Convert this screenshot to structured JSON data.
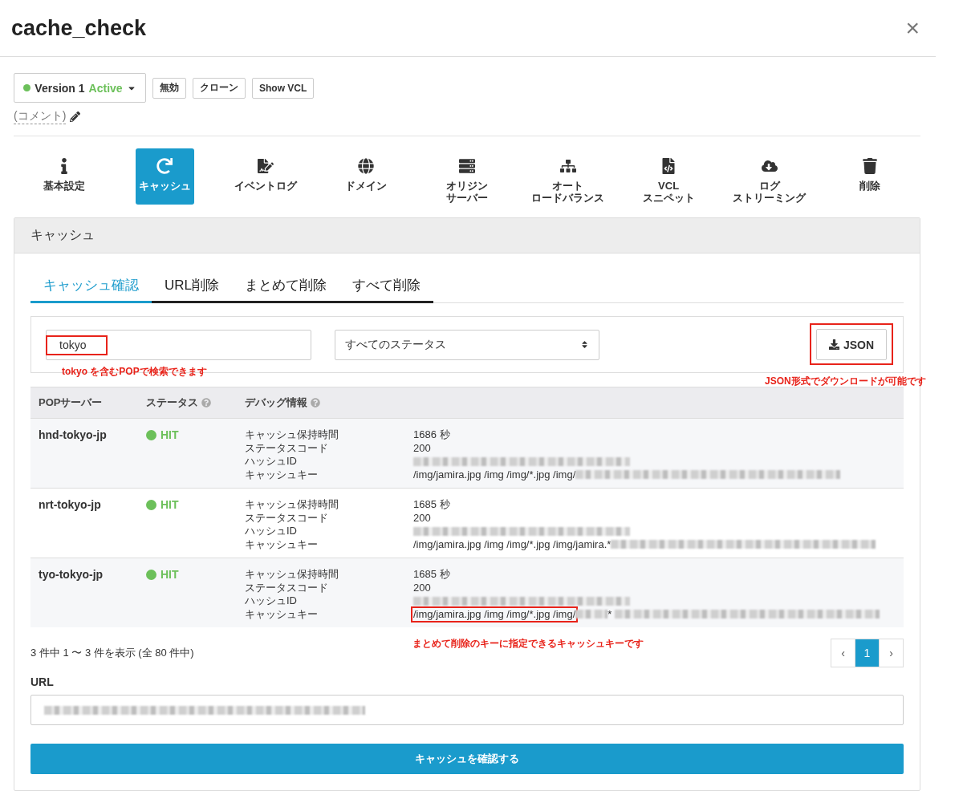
{
  "dialog": {
    "title": "cache_check",
    "close": "×"
  },
  "version": {
    "label": "Version 1",
    "status": "Active",
    "active": true
  },
  "version_buttons": [
    "無効",
    "クローン",
    "Show VCL"
  ],
  "comment": "(コメント)",
  "nav": [
    {
      "lines": [
        "基本設定"
      ],
      "selected": false
    },
    {
      "lines": [
        "キャッシュ"
      ],
      "selected": true
    },
    {
      "lines": [
        "イベントログ"
      ],
      "selected": false
    },
    {
      "lines": [
        "ドメイン"
      ],
      "selected": false
    },
    {
      "lines": [
        "オリジン",
        "サーバー"
      ],
      "selected": false
    },
    {
      "lines": [
        "オート",
        "ロードバランス"
      ],
      "selected": false
    },
    {
      "lines": [
        "VCL",
        "スニペット"
      ],
      "selected": false
    },
    {
      "lines": [
        "ログ",
        "ストリーミング"
      ],
      "selected": false
    },
    {
      "lines": [
        "削除"
      ],
      "selected": false
    }
  ],
  "panel_title": "キャッシュ",
  "tabs": [
    {
      "label": "キャッシュ確認",
      "selected": true
    },
    {
      "label": "URL削除",
      "selected": false
    },
    {
      "label": "まとめて削除",
      "selected": false
    },
    {
      "label": "すべて削除",
      "selected": false
    }
  ],
  "search": {
    "value": "tokyo"
  },
  "status_filter": "すべてのステータス",
  "json_button": "JSON",
  "table": {
    "columns": [
      {
        "label": "POPサーバー"
      },
      {
        "label": "ステータス",
        "help": true
      },
      {
        "label": "デバッグ情報",
        "help": true
      }
    ],
    "rows": [
      {
        "pop": "hnd-tokyo-jp",
        "status": "HIT",
        "hit": true,
        "debug": [
          {
            "label": "キャッシュ保持時間",
            "segments": [
              {
                "kind": "text",
                "text": "1686 秒"
              }
            ]
          },
          {
            "label": "ステータスコード",
            "segments": [
              {
                "kind": "text",
                "text": "200"
              }
            ]
          },
          {
            "label": "ハッシュID",
            "segments": [
              {
                "kind": "blur"
              }
            ]
          },
          {
            "label": "キャッシュキー",
            "segments": [
              {
                "kind": "text",
                "text": "/img/jamira.jpg /img /img/*.jpg /img/",
                "highlighted": false
              },
              {
                "kind": "blur"
              }
            ]
          }
        ]
      },
      {
        "pop": "nrt-tokyo-jp",
        "status": "HIT",
        "hit": true,
        "debug": [
          {
            "label": "キャッシュ保持時間",
            "segments": [
              {
                "kind": "text",
                "text": "1685 秒"
              }
            ]
          },
          {
            "label": "ステータスコード",
            "segments": [
              {
                "kind": "text",
                "text": "200"
              }
            ]
          },
          {
            "label": "ハッシュID",
            "segments": [
              {
                "kind": "blur"
              }
            ]
          },
          {
            "label": "キャッシュキー",
            "segments": [
              {
                "kind": "text",
                "text": "/img/jamira.jpg /img /img/*.jpg /img/jamira.*",
                "highlighted": false
              },
              {
                "kind": "blur"
              }
            ]
          }
        ]
      },
      {
        "pop": "tyo-tokyo-jp",
        "status": "HIT",
        "hit": true,
        "debug": [
          {
            "label": "キャッシュ保持時間",
            "segments": [
              {
                "kind": "text",
                "text": "1685 秒"
              }
            ]
          },
          {
            "label": "ステータスコード",
            "segments": [
              {
                "kind": "text",
                "text": "200"
              }
            ]
          },
          {
            "label": "ハッシュID",
            "segments": [
              {
                "kind": "blur"
              }
            ]
          },
          {
            "label": "キャッシュキー",
            "segments": [
              {
                "kind": "text",
                "text": "/img/jamira.jpg /img /img/*.jpg /img/",
                "highlighted": true
              },
              {
                "kind": "blur"
              },
              {
                "kind": "text",
                "text": "*",
                "highlighted": false
              },
              {
                "kind": "blur"
              }
            ]
          }
        ]
      }
    ]
  },
  "summary": "3 件中 1 〜 3 件を表示 (全 80 件中)",
  "pagination": {
    "prev": "‹",
    "pages": [
      {
        "label": "1",
        "selected": true
      }
    ],
    "next": "›"
  },
  "url": {
    "label": "URL",
    "value": [
      {
        "kind": "blur"
      }
    ]
  },
  "submit": "キャッシュを確認する",
  "annotations": {
    "search": "tokyo を含むPOPで検索できます",
    "json": "JSON形式でダウンロードが可能です",
    "key": "まとめて削除のキーに指定できるキャッシュキーです"
  }
}
